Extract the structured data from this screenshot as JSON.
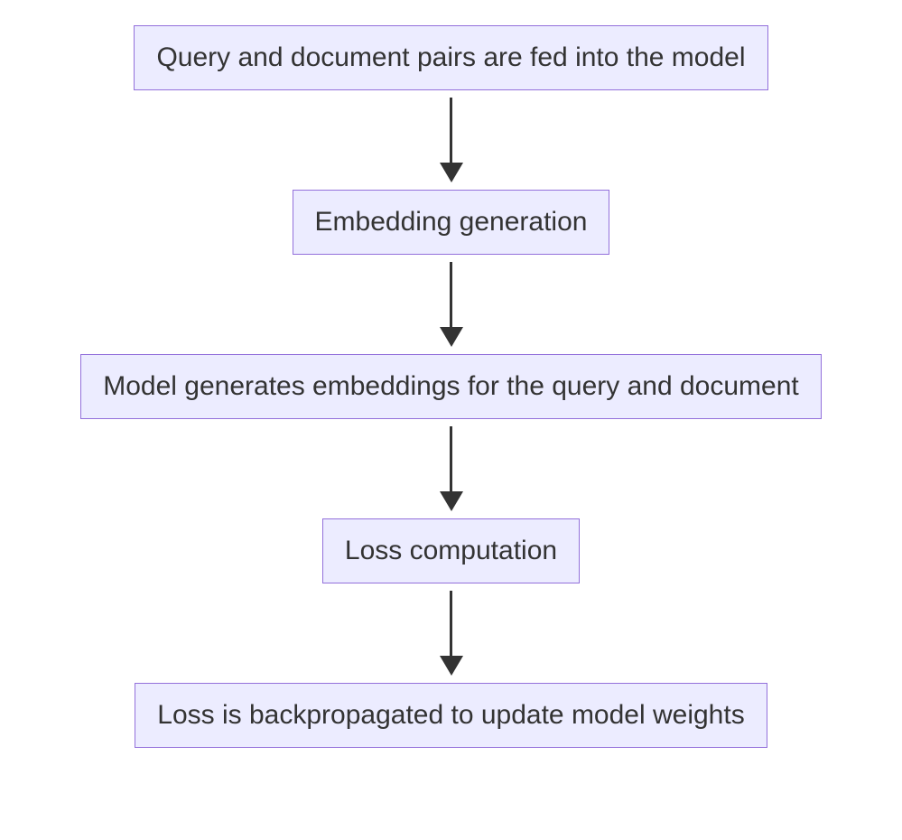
{
  "diagram": {
    "nodes": [
      {
        "id": "node-1",
        "label": "Query and document pairs are fed into the model"
      },
      {
        "id": "node-2",
        "label": "Embedding generation"
      },
      {
        "id": "node-3",
        "label": "Model generates embeddings for the query and document"
      },
      {
        "id": "node-4",
        "label": "Loss computation"
      },
      {
        "id": "node-5",
        "label": "Loss is backpropagated to update model weights"
      }
    ],
    "edges": [
      {
        "from": "node-1",
        "to": "node-2"
      },
      {
        "from": "node-2",
        "to": "node-3"
      },
      {
        "from": "node-3",
        "to": "node-4"
      },
      {
        "from": "node-4",
        "to": "node-5"
      }
    ],
    "colors": {
      "node_fill": "#ECECFF",
      "node_border": "#9370DB",
      "arrow": "#333333",
      "text": "#333333"
    }
  }
}
